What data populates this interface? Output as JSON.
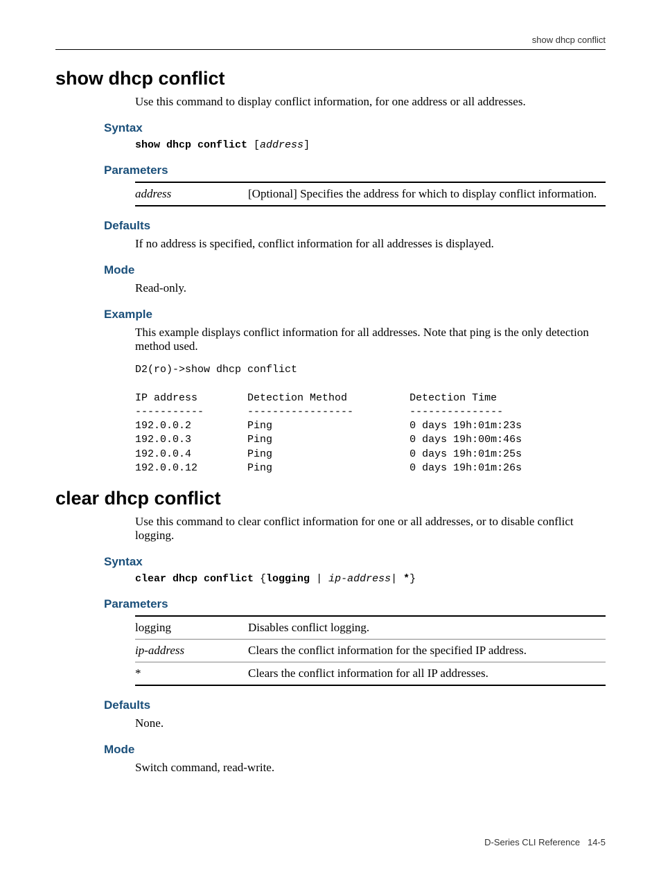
{
  "running_head": "show dhcp conflict",
  "sections": [
    {
      "title": "show dhcp conflict",
      "intro": "Use this command to display conflict information, for one address or all addresses.",
      "syntax_heading": "Syntax",
      "syntax": {
        "cmd": "show dhcp conflict",
        "bracket_open": " [",
        "arg": "address",
        "bracket_close": "]"
      },
      "parameters_heading": "Parameters",
      "parameters": [
        {
          "name": "address",
          "italic": true,
          "desc": "[Optional] Specifies the address for which to display conflict information."
        }
      ],
      "defaults_heading": "Defaults",
      "defaults_text": "If no address is specified, conflict information for all addresses is displayed.",
      "mode_heading": "Mode",
      "mode_text": "Read-only.",
      "example_heading": "Example",
      "example_text": "This example displays conflict information for all addresses. Note that ping is the only detection method used.",
      "example_output": "D2(ro)->show dhcp conflict\n\nIP address        Detection Method          Detection Time\n-----------       -----------------         ---------------\n192.0.0.2         Ping                      0 days 19h:01m:23s\n192.0.0.3         Ping                      0 days 19h:00m:46s\n192.0.0.4         Ping                      0 days 19h:01m:25s\n192.0.0.12        Ping                      0 days 19h:01m:26s"
    },
    {
      "title": "clear dhcp conflict",
      "intro": "Use this command to clear conflict information for one or all addresses, or to disable conflict logging.",
      "syntax_heading": "Syntax",
      "syntax": {
        "cmd": "clear dhcp conflict",
        "brace_open": " {",
        "kw2": "logging",
        "pipe1": " | ",
        "arg": "ip-address",
        "pipe2": "| ",
        "kw3": "*",
        "brace_close": "}"
      },
      "parameters_heading": "Parameters",
      "parameters": [
        {
          "name": "logging",
          "italic": false,
          "desc": "Disables conflict logging."
        },
        {
          "name": "ip-address",
          "italic": true,
          "desc": "Clears the conflict information for the specified IP address."
        },
        {
          "name": "*",
          "italic": false,
          "desc": "Clears the conflict information for all IP addresses."
        }
      ],
      "defaults_heading": "Defaults",
      "defaults_text": "None.",
      "mode_heading": "Mode",
      "mode_text": "Switch command, read-write."
    }
  ],
  "footer": {
    "doc": "D-Series CLI Reference",
    "page": "14-5"
  }
}
